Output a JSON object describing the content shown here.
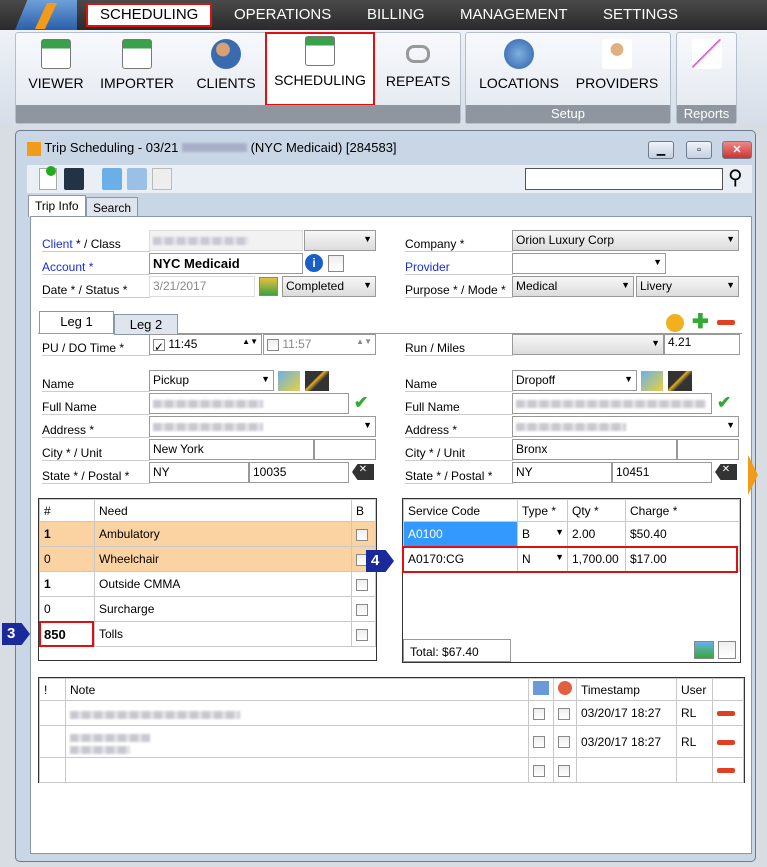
{
  "menu": {
    "items": [
      "SCHEDULING",
      "OPERATIONS",
      "BILLING",
      "MANAGEMENT",
      "SETTINGS"
    ]
  },
  "ribbon": {
    "buttons": [
      "VIEWER",
      "IMPORTER",
      "CLIENTS",
      "SCHEDULING",
      "REPEATS",
      "LOCATIONS",
      "PROVIDERS"
    ],
    "groups": [
      "Setup",
      "Reports"
    ]
  },
  "window": {
    "title": "Trip Scheduling - 03/21",
    "title_suffix": "(NYC Medicaid) [284583]",
    "search_value": ""
  },
  "tabs": [
    "Trip Info",
    "Search"
  ],
  "form": {
    "client_label": "Client",
    "class_label": " * / Class",
    "account_label": "Account *",
    "date_status_label": "Date * / Status *",
    "account": "NYC Medicaid",
    "date": "3/21/2017",
    "status": "Completed",
    "company_label": "Company *",
    "company": "Orion Luxury Corp",
    "provider_label": "Provider",
    "provider": "",
    "purpose_mode_label": "Purpose * / Mode *",
    "purpose": "Medical",
    "mode": "Livery"
  },
  "legs": {
    "tabs": [
      "Leg 1",
      "Leg 2"
    ],
    "pu_do_label": "PU / DO Time *",
    "pu_time": "11:45",
    "do_time": "11:57",
    "run_miles_label": "Run / Miles",
    "miles": "4.21"
  },
  "pickup": {
    "name_label": "Name",
    "fullname_label": "Full Name",
    "address_label": "Address *",
    "city_label": "City * / Unit",
    "state_label": "State * / Postal *",
    "name": "Pickup",
    "city": "New York",
    "state": "NY",
    "postal": "10035"
  },
  "dropoff": {
    "name_label": "Name",
    "fullname_label": "Full Name",
    "address_label": "Address *",
    "city_label": "City * / Unit",
    "state_label": "State * / Postal *",
    "name": "Dropoff",
    "city": "Bronx",
    "state": "NY",
    "postal": "10451"
  },
  "needs": {
    "headers": [
      "#",
      "Need",
      "B"
    ],
    "rows": [
      {
        "n": "1",
        "need": "Ambulatory"
      },
      {
        "n": "0",
        "need": "Wheelchair"
      },
      {
        "n": "1",
        "need": "Outside CMMA"
      },
      {
        "n": "0",
        "need": "Surcharge"
      },
      {
        "n": "850",
        "need": "Tolls"
      }
    ]
  },
  "services": {
    "headers": [
      "Service Code",
      "Type *",
      "Qty *",
      "Charge *"
    ],
    "rows": [
      {
        "code": "A0100",
        "type": "B",
        "qty": "2.00",
        "charge": "$50.40"
      },
      {
        "code": "A0170:CG",
        "type": "N",
        "qty": "1,700.00",
        "charge": "$17.00"
      }
    ],
    "total": "Total: $67.40"
  },
  "notes": {
    "headers": [
      "!",
      "Note",
      "",
      "",
      "Timestamp",
      "User"
    ],
    "rows": [
      {
        "ts": "03/20/17 18:27",
        "user": "RL"
      },
      {
        "ts": "03/20/17 18:27",
        "user": "RL"
      },
      {
        "ts": "",
        "user": ""
      }
    ]
  },
  "callouts": [
    "3",
    "4"
  ],
  "colors": {
    "highlight": "#e01010",
    "callout": "#1a2a9a",
    "need_highlight": "#fbd3a2",
    "selected_cell": "#3399ff"
  }
}
